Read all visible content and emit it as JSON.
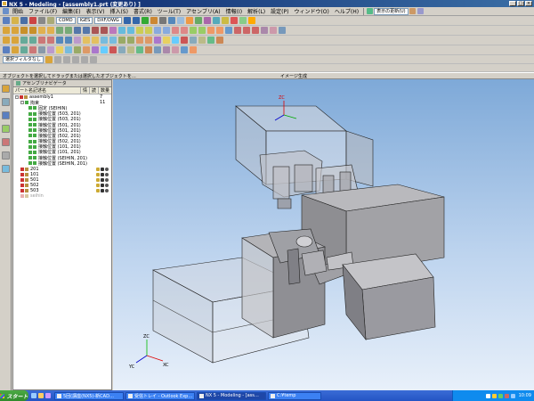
{
  "window": {
    "title": "NX 5 - Modeling - [assembly1.prt (変更あり) ]",
    "controls": [
      "_",
      "□",
      "×"
    ]
  },
  "menubar": {
    "start_label": "開始",
    "items": [
      "ファイル(F)",
      "編集(E)",
      "表示(V)",
      "挿入(S)",
      "書式(R)",
      "ツール(T)",
      "アセンブリ(A)",
      "情報(I)",
      "解析(L)",
      "設定(P)",
      "ウィンドウ(O)",
      "ヘルプ(H)"
    ],
    "combo_label": "表示の更新(U)"
  },
  "toolbar4": {
    "selection_filter": "選択フィルタなし"
  },
  "status": {
    "left": "オブジェクトを選択してドラッグまたは選択したオブジェクトを…",
    "center": "イメージ生成"
  },
  "navigator": {
    "header": "アセンブリナビゲータ",
    "col_name": "パート名記述名",
    "col_info": "情",
    "col_read": "読",
    "col_qty": "数量",
    "rows": [
      {
        "label": "assembly1",
        "qty": "7",
        "level": 0,
        "expander": "-"
      },
      {
        "label": "拘束",
        "qty": "11",
        "level": 1,
        "expander": "-"
      },
      {
        "label": "固定 (SEIHIN)",
        "level": 2
      },
      {
        "label": "接触位置 (503, 201)",
        "level": 2
      },
      {
        "label": "接触位置 (503, 201)",
        "level": 2
      },
      {
        "label": "接触位置 (501, 201)",
        "level": 2
      },
      {
        "label": "接触位置 (501, 201)",
        "level": 2
      },
      {
        "label": "接触位置 (502, 201)",
        "level": 2
      },
      {
        "label": "接触位置 (502, 201)",
        "level": 2
      },
      {
        "label": "接触位置 (101, 201)",
        "level": 2
      },
      {
        "label": "接触位置 (101, 201)",
        "level": 2
      },
      {
        "label": "接触位置 (SEIHIN, 201)",
        "level": 2
      },
      {
        "label": "接触位置 (SEIHIN, 201)",
        "level": 2
      },
      {
        "label": "201",
        "level": 1,
        "part": true
      },
      {
        "label": "101",
        "level": 1,
        "part": true
      },
      {
        "label": "501",
        "level": 1,
        "part": true
      },
      {
        "label": "502",
        "level": 1,
        "part": true
      },
      {
        "label": "503",
        "level": 1,
        "part": true
      },
      {
        "label": "seihin",
        "level": 1,
        "part": true,
        "dim": true
      }
    ]
  },
  "viewport": {
    "axis_labels": {
      "zc": "ZC",
      "xc": "XC",
      "yc": "YC"
    },
    "wcs_label": "ZC"
  },
  "taskbar": {
    "start": "スタート",
    "tasks": [
      {
        "label": "5回(講座(NX5)-新CAD…"
      },
      {
        "label": "受信トレイ - Outlook Exp…"
      },
      {
        "label": "NX 5 - Modeling - [ass…",
        "active": true
      },
      {
        "label": "C:¥temp"
      }
    ],
    "clock": "10:09"
  },
  "colors": {
    "title_start": "#0a246a",
    "title_end": "#3a6ea5",
    "viewport_top": "#7ea9d8",
    "viewport_bottom": "#e8f0fa",
    "taskbar": "#2454c4",
    "start_green": "#3a9a35"
  }
}
